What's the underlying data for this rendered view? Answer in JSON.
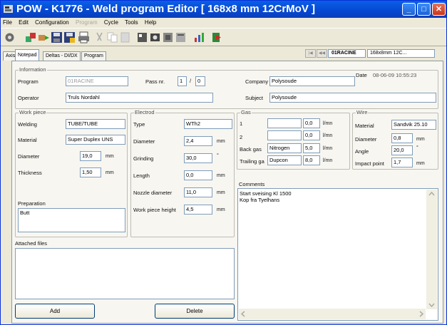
{
  "window": {
    "title": "POW - K1776 - Weld program Editor  [ 168x8 mm 12CrMoV ]"
  },
  "menu": [
    "File",
    "Edit",
    "Configuration",
    "Program",
    "Cycle",
    "Tools",
    "Help"
  ],
  "tabs": [
    "Axis",
    "Notepad",
    "Deltas - DI/DX",
    "Program"
  ],
  "active_tab": "Notepad",
  "program_nav": {
    "name": "01RACINE",
    "desc": "168x8mm 12C..."
  },
  "information": {
    "title": "Information",
    "program_label": "Program",
    "program_value": "01RACINE",
    "pass_label": "Pass nr.",
    "pass_value": "1",
    "pass_sep": "/",
    "pass_total": "0",
    "company_label": "Company",
    "company_value": "Polysoude",
    "date_label": "Date",
    "date_value": "08-06-09 10:55:23",
    "operator_label": "Operator",
    "operator_value": "Truls Nordahl",
    "subject_label": "Subject",
    "subject_value": "Polysoude"
  },
  "workpiece": {
    "title": "Work piece",
    "welding_label": "Welding",
    "welding_value": "TUBE/TUBE",
    "material_label": "Material",
    "material_value": "Super Duplex UNS",
    "diameter_label": "Diameter",
    "diameter_value": "19,0",
    "diameter_unit": "mm",
    "thickness_label": "Thickness",
    "thickness_value": "1,50",
    "thickness_unit": "mm",
    "preparation_label": "Preparation",
    "preparation_value": "Butt"
  },
  "electrode": {
    "title": "Electrod",
    "type_label": "Type",
    "type_value": "WTh2",
    "diameter_label": "Diameter",
    "diameter_value": "2,4",
    "diameter_unit": "mm",
    "grinding_label": "Grinding",
    "grinding_value": "30,0",
    "grinding_unit": "°",
    "length_label": "Length",
    "length_value": "0,0",
    "length_unit": "mm",
    "nozzle_label": "Nozzle diameter",
    "nozzle_value": "11,0",
    "nozzle_unit": "mm",
    "wph_label": "Work piece height",
    "wph_value": "4,5",
    "wph_unit": "mm"
  },
  "gas": {
    "title": "Gas",
    "rows": [
      {
        "label": "1",
        "name": "",
        "value": "0,0",
        "unit": "l/mn"
      },
      {
        "label": "2",
        "name": "",
        "value": "0,0",
        "unit": "l/mn"
      },
      {
        "label": "Back gas",
        "name": "Nitrogen",
        "value": "5,0",
        "unit": "l/mn"
      },
      {
        "label": "Trailing ga",
        "name": "Dupcon",
        "value": "8,0",
        "unit": "l/mn"
      }
    ]
  },
  "wire": {
    "title": "Wire",
    "material_label": "Material",
    "material_value": "Sandvik 25.10",
    "diameter_label": "Diameter",
    "diameter_value": "0,8",
    "diameter_unit": "mm",
    "angle_label": "Angle",
    "angle_value": "20,0",
    "angle_unit": "°",
    "impact_label": "Impact point",
    "impact_value": "1,7",
    "impact_unit": "mm"
  },
  "comments": {
    "label": "Comments",
    "line1": "Start sveising Kl 1500",
    "line2": "Kop fra Tyelhans"
  },
  "attached": {
    "label": "Attached files",
    "add_label": "Add",
    "delete_label": "Delete"
  },
  "colors": {
    "titlebar": "#0a5fe8",
    "face": "#ece9d8",
    "panel": "#f7f6f1",
    "input_border": "#7f9db9"
  }
}
